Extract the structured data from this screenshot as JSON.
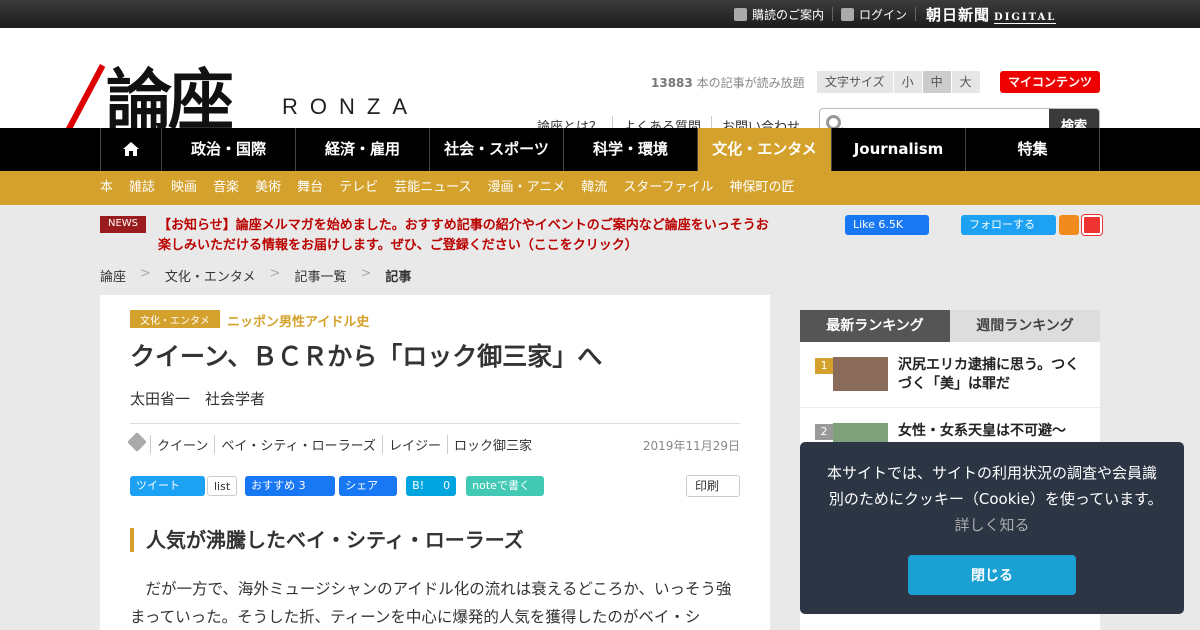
{
  "topbar": {
    "guide": "購読のご案内",
    "login": "ログイン",
    "asahi_logo": "朝日新聞",
    "asahi_digital": "DIGITAL"
  },
  "header": {
    "logo_jp": "論座",
    "logo_en": "RONZA",
    "count_number": "13883",
    "count_text": " 本の記事が読み放題",
    "font_size_label": "文字サイズ",
    "font_small": "小",
    "font_medium": "中",
    "font_large": "大",
    "my_contents": "マイコンテンツ",
    "links": [
      "論座とは？",
      "よくある質問",
      "お問い合わせ"
    ],
    "search_button": "検索"
  },
  "nav": [
    "政治・国際",
    "経済・雇用",
    "社会・スポーツ",
    "科学・環境",
    "文化・エンタメ",
    "Journalism",
    "特集"
  ],
  "subnav": [
    "本",
    "雑誌",
    "映画",
    "音楽",
    "美術",
    "舞台",
    "テレビ",
    "芸能ニュース",
    "漫画・アニメ",
    "韓流",
    "スターファイル",
    "神保町の匠"
  ],
  "news": {
    "badge": "NEWS",
    "text": "【お知らせ】論座メルマガを始めました。おすすめ記事の紹介やイベントのご案内など論座をいっそうお楽しみいただける情報をお届けします。ぜひ、ご登録ください（ここをクリック）"
  },
  "social": {
    "fb_like": "Like 6.5K",
    "tw_follow": "フォローする"
  },
  "breadcrumb": [
    "論座",
    "文化・エンタメ",
    "記事一覧",
    "記事"
  ],
  "article": {
    "category": "文化・エンタメ",
    "series": "ニッポン男性アイドル史",
    "title": "クイーン、ＢＣＲから「ロック御三家」へ",
    "author": "太田省一　社会学者",
    "tags": [
      "クイーン",
      "ベイ・シティ・ローラーズ",
      "レイジー",
      "ロック御三家"
    ],
    "date": "2019年11月29日",
    "share": {
      "tweet": "ツイート",
      "list": "list",
      "fb": "おすすめ 3",
      "fb_share": "シェア",
      "hatena": "B!",
      "hatena_count": "0",
      "note": "noteで書く",
      "print": "印刷"
    },
    "heading": "人気が沸騰したベイ・シティ・ローラーズ",
    "body": "だが一方で、海外ミュージシャンのアイドル化の流れは衰えるどころか、いっそう強まっていった。そうした折、ティーンを中心に爆発的人気を獲得したのがベイ・シ"
  },
  "ranking": {
    "tab_latest": "最新ランキング",
    "tab_weekly": "週間ランキング",
    "items": [
      {
        "rank": "1",
        "title": "沢尻エリカ逮捕に思う。つくづく「美」は罪だ"
      },
      {
        "rank": "2",
        "title": "女性・女系天皇は不可避～"
      }
    ]
  },
  "cookie": {
    "text": "本サイトでは、サイトの利用状況の調査や会員識別のためにクッキー（Cookie）を使っています。",
    "more": "詳しく知る",
    "close": "閉じる"
  }
}
